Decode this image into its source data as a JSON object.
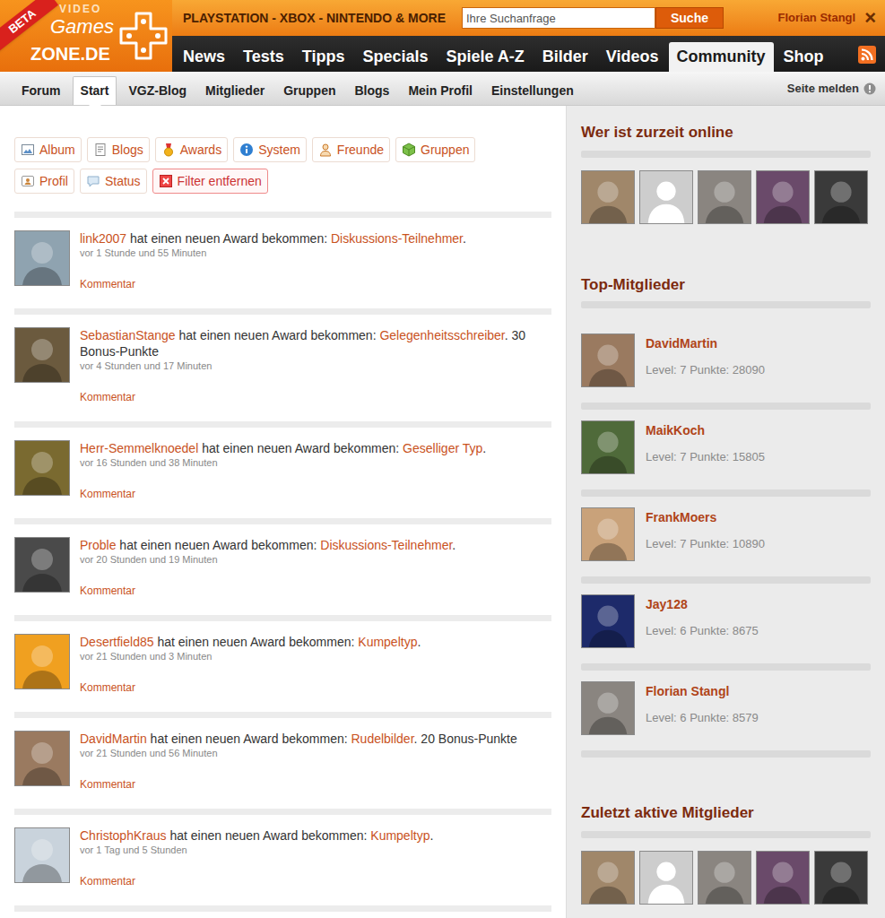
{
  "header": {
    "logo": {
      "badge": "BETA",
      "line1": "VIDEO",
      "line2": "Games",
      "line3": "ZONE.DE"
    },
    "tagline": "PLAYSTATION - XBOX - NINTENDO & MORE",
    "search": {
      "placeholder": "Ihre Suchanfrage",
      "button": "Suche"
    },
    "user": "Florian Stangl",
    "close": "×"
  },
  "nav": [
    {
      "label": "News",
      "selected": false
    },
    {
      "label": "Tests",
      "selected": false
    },
    {
      "label": "Tipps",
      "selected": false
    },
    {
      "label": "Specials",
      "selected": false
    },
    {
      "label": "Spiele A-Z",
      "selected": false
    },
    {
      "label": "Bilder",
      "selected": false
    },
    {
      "label": "Videos",
      "selected": false
    },
    {
      "label": "Community",
      "selected": true
    },
    {
      "label": "Shop",
      "selected": false
    }
  ],
  "subnav": [
    {
      "label": "Forum",
      "selected": false
    },
    {
      "label": "Start",
      "selected": true
    },
    {
      "label": "VGZ-Blog",
      "selected": false
    },
    {
      "label": "Mitglieder",
      "selected": false
    },
    {
      "label": "Gruppen",
      "selected": false
    },
    {
      "label": "Blogs",
      "selected": false
    },
    {
      "label": "Mein Profil",
      "selected": false
    },
    {
      "label": "Einstellungen",
      "selected": false
    }
  ],
  "report": "Seite melden",
  "filter_rows": [
    {
      "items": [
        {
          "label": "Album",
          "kind": "album"
        },
        {
          "label": "Blogs",
          "kind": "blogs"
        },
        {
          "label": "Awards",
          "kind": "awards"
        },
        {
          "label": "System",
          "kind": "system"
        },
        {
          "label": "Freunde",
          "kind": "friends"
        },
        {
          "label": "Gruppen",
          "kind": "groups"
        }
      ]
    },
    {
      "items": [
        {
          "label": "Profil",
          "kind": "profile"
        },
        {
          "label": "Status",
          "kind": "status"
        },
        {
          "label": "Filter entfernen",
          "kind": "remove"
        }
      ]
    }
  ],
  "activity": [
    {
      "user": "link2007",
      "verb": "hat einen neuen Award bekommen:",
      "award": "Diskussions-Teilnehmer",
      "punct": ".",
      "time": "vor 1 Stunde und 55 Minuten",
      "comment": "Kommentar"
    },
    {
      "user": "SebastianStange",
      "verb": "hat einen neuen Award bekommen:",
      "award": "Gelegenheitsschreiber",
      "punct": ".",
      "bonus": "30 Bonus-Punkte",
      "time": "vor 4 Stunden und 17 Minuten",
      "comment": "Kommentar"
    },
    {
      "user": "Herr-Semmelknoedel",
      "verb": "hat einen neuen Award bekommen:",
      "award": "Geselliger Typ",
      "punct": ".",
      "time": "vor 16 Stunden und 38 Minuten",
      "comment": "Kommentar"
    },
    {
      "user": "Proble",
      "verb": "hat einen neuen Award bekommen:",
      "award": "Diskussions-Teilnehmer",
      "punct": ".",
      "time": "vor 20 Stunden und 19 Minuten",
      "comment": "Kommentar"
    },
    {
      "user": "Desertfield85",
      "verb": "hat einen neuen Award bekommen:",
      "award": "Kumpeltyp",
      "punct": ".",
      "time": "vor 21 Stunden und 3 Minuten",
      "comment": "Kommentar"
    },
    {
      "user": "DavidMartin",
      "verb": "hat einen neuen Award bekommen:",
      "award": "Rudelbilder",
      "punct": ".",
      "bonus": "20 Bonus-Punkte",
      "time": "vor 21 Stunden und 56 Minuten",
      "comment": "Kommentar"
    },
    {
      "user": "ChristophKraus",
      "verb": "hat einen neuen Award bekommen:",
      "award": "Kumpeltyp",
      "punct": ".",
      "time": "vor 1 Tag und 5 Stunden",
      "comment": "Kommentar"
    }
  ],
  "online": {
    "title": "Wer ist zurzeit online",
    "avatars": [
      {
        "kind": "photo"
      },
      {
        "kind": "placeholder"
      },
      {
        "kind": "photo"
      },
      {
        "kind": "photo"
      },
      {
        "kind": "photo"
      }
    ]
  },
  "top": {
    "title": "Top-Mitglieder",
    "members": [
      {
        "name": "DavidMartin",
        "stats": "Level: 7 Punkte: 28090"
      },
      {
        "name": "MaikKoch",
        "stats": "Level: 7 Punkte: 15805"
      },
      {
        "name": "FrankMoers",
        "stats": "Level: 7 Punkte: 10890"
      },
      {
        "name": "Jay128",
        "stats": "Level: 6 Punkte: 8675"
      },
      {
        "name": "Florian Stangl",
        "stats": "Level: 6 Punkte: 8579"
      }
    ]
  },
  "recent": {
    "title": "Zuletzt aktive Mitglieder",
    "avatars": [
      {
        "kind": "photo"
      },
      {
        "kind": "placeholder"
      },
      {
        "kind": "photo"
      },
      {
        "kind": "photo"
      },
      {
        "kind": "photo"
      }
    ]
  }
}
